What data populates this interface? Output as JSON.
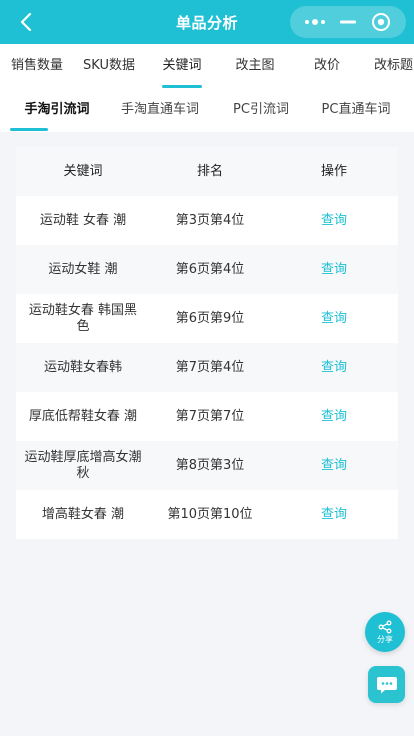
{
  "header": {
    "title": "单品分析"
  },
  "tabs_primary": [
    {
      "label": "销售数量"
    },
    {
      "label": "SKU数据"
    },
    {
      "label": "关键词"
    },
    {
      "label": "改主图"
    },
    {
      "label": "改价"
    },
    {
      "label": "改标题"
    }
  ],
  "tabs_secondary": [
    {
      "label": "手淘引流词"
    },
    {
      "label": "手淘直通车词"
    },
    {
      "label": "PC引流词"
    },
    {
      "label": "PC直通车词"
    }
  ],
  "table": {
    "headers": [
      "关键词",
      "排名",
      "操作"
    ],
    "rows": [
      {
        "keyword": "运动鞋 女春 潮",
        "rank": "第3页第4位",
        "action": "查询"
      },
      {
        "keyword": "运动女鞋 潮",
        "rank": "第6页第4位",
        "action": "查询"
      },
      {
        "keyword": "运动鞋女春 韩国黑色",
        "rank": "第6页第9位",
        "action": "查询"
      },
      {
        "keyword": "运动鞋女春韩",
        "rank": "第7页第4位",
        "action": "查询"
      },
      {
        "keyword": "厚底低帮鞋女春 潮",
        "rank": "第7页第7位",
        "action": "查询"
      },
      {
        "keyword": "运动鞋厚底增高女潮秋",
        "rank": "第8页第3位",
        "action": "查询"
      },
      {
        "keyword": "增高鞋女春 潮",
        "rank": "第10页第10位",
        "action": "查询"
      }
    ]
  },
  "share": {
    "label": "分享"
  },
  "colors": {
    "accent": "#1fc0d3"
  }
}
